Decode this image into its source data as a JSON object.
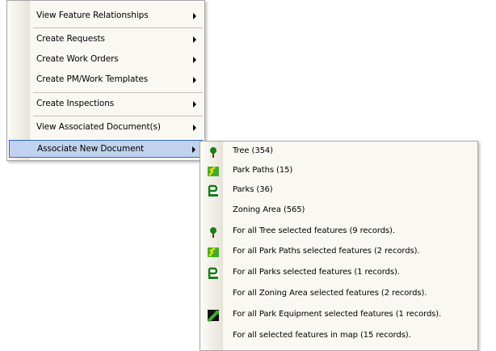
{
  "main_menu": {
    "items": [
      {
        "label": "View Feature Relationships",
        "has_submenu": true
      },
      {
        "label": "Create Requests",
        "has_submenu": true
      },
      {
        "label": "Create Work Orders",
        "has_submenu": true
      },
      {
        "label": "Create PM/Work Templates",
        "has_submenu": true
      },
      {
        "label": "Create Inspections",
        "has_submenu": true
      },
      {
        "label": "View Associated Document(s)",
        "has_submenu": true
      },
      {
        "label": "Associate New Document",
        "has_submenu": true,
        "highlighted": true
      }
    ]
  },
  "sub_menu": {
    "items": [
      {
        "label": "Tree (354)",
        "icon": "tree-icon"
      },
      {
        "label": "Park Paths (15)",
        "icon": "park-paths-icon"
      },
      {
        "label": "Parks (36)",
        "icon": "parks-icon"
      },
      {
        "label": "Zoning Area (565)",
        "icon": ""
      },
      {
        "label": "For all Tree selected features (9 records).",
        "icon": "tree-icon"
      },
      {
        "label": "For all Park Paths selected features (2 records).",
        "icon": "park-paths-icon"
      },
      {
        "label": "For all Parks selected features (1 records).",
        "icon": "parks-icon"
      },
      {
        "label": "For all Zoning Area selected features (2 records).",
        "icon": ""
      },
      {
        "label": "For all Park Equipment selected features (1 records).",
        "icon": "park-equipment-icon"
      },
      {
        "label": "For all selected features in map (15 records).",
        "icon": ""
      }
    ]
  },
  "colors": {
    "highlight_fill": "#c1d2ee",
    "highlight_border": "#316ac5",
    "menu_background": "#f9f8f3"
  }
}
